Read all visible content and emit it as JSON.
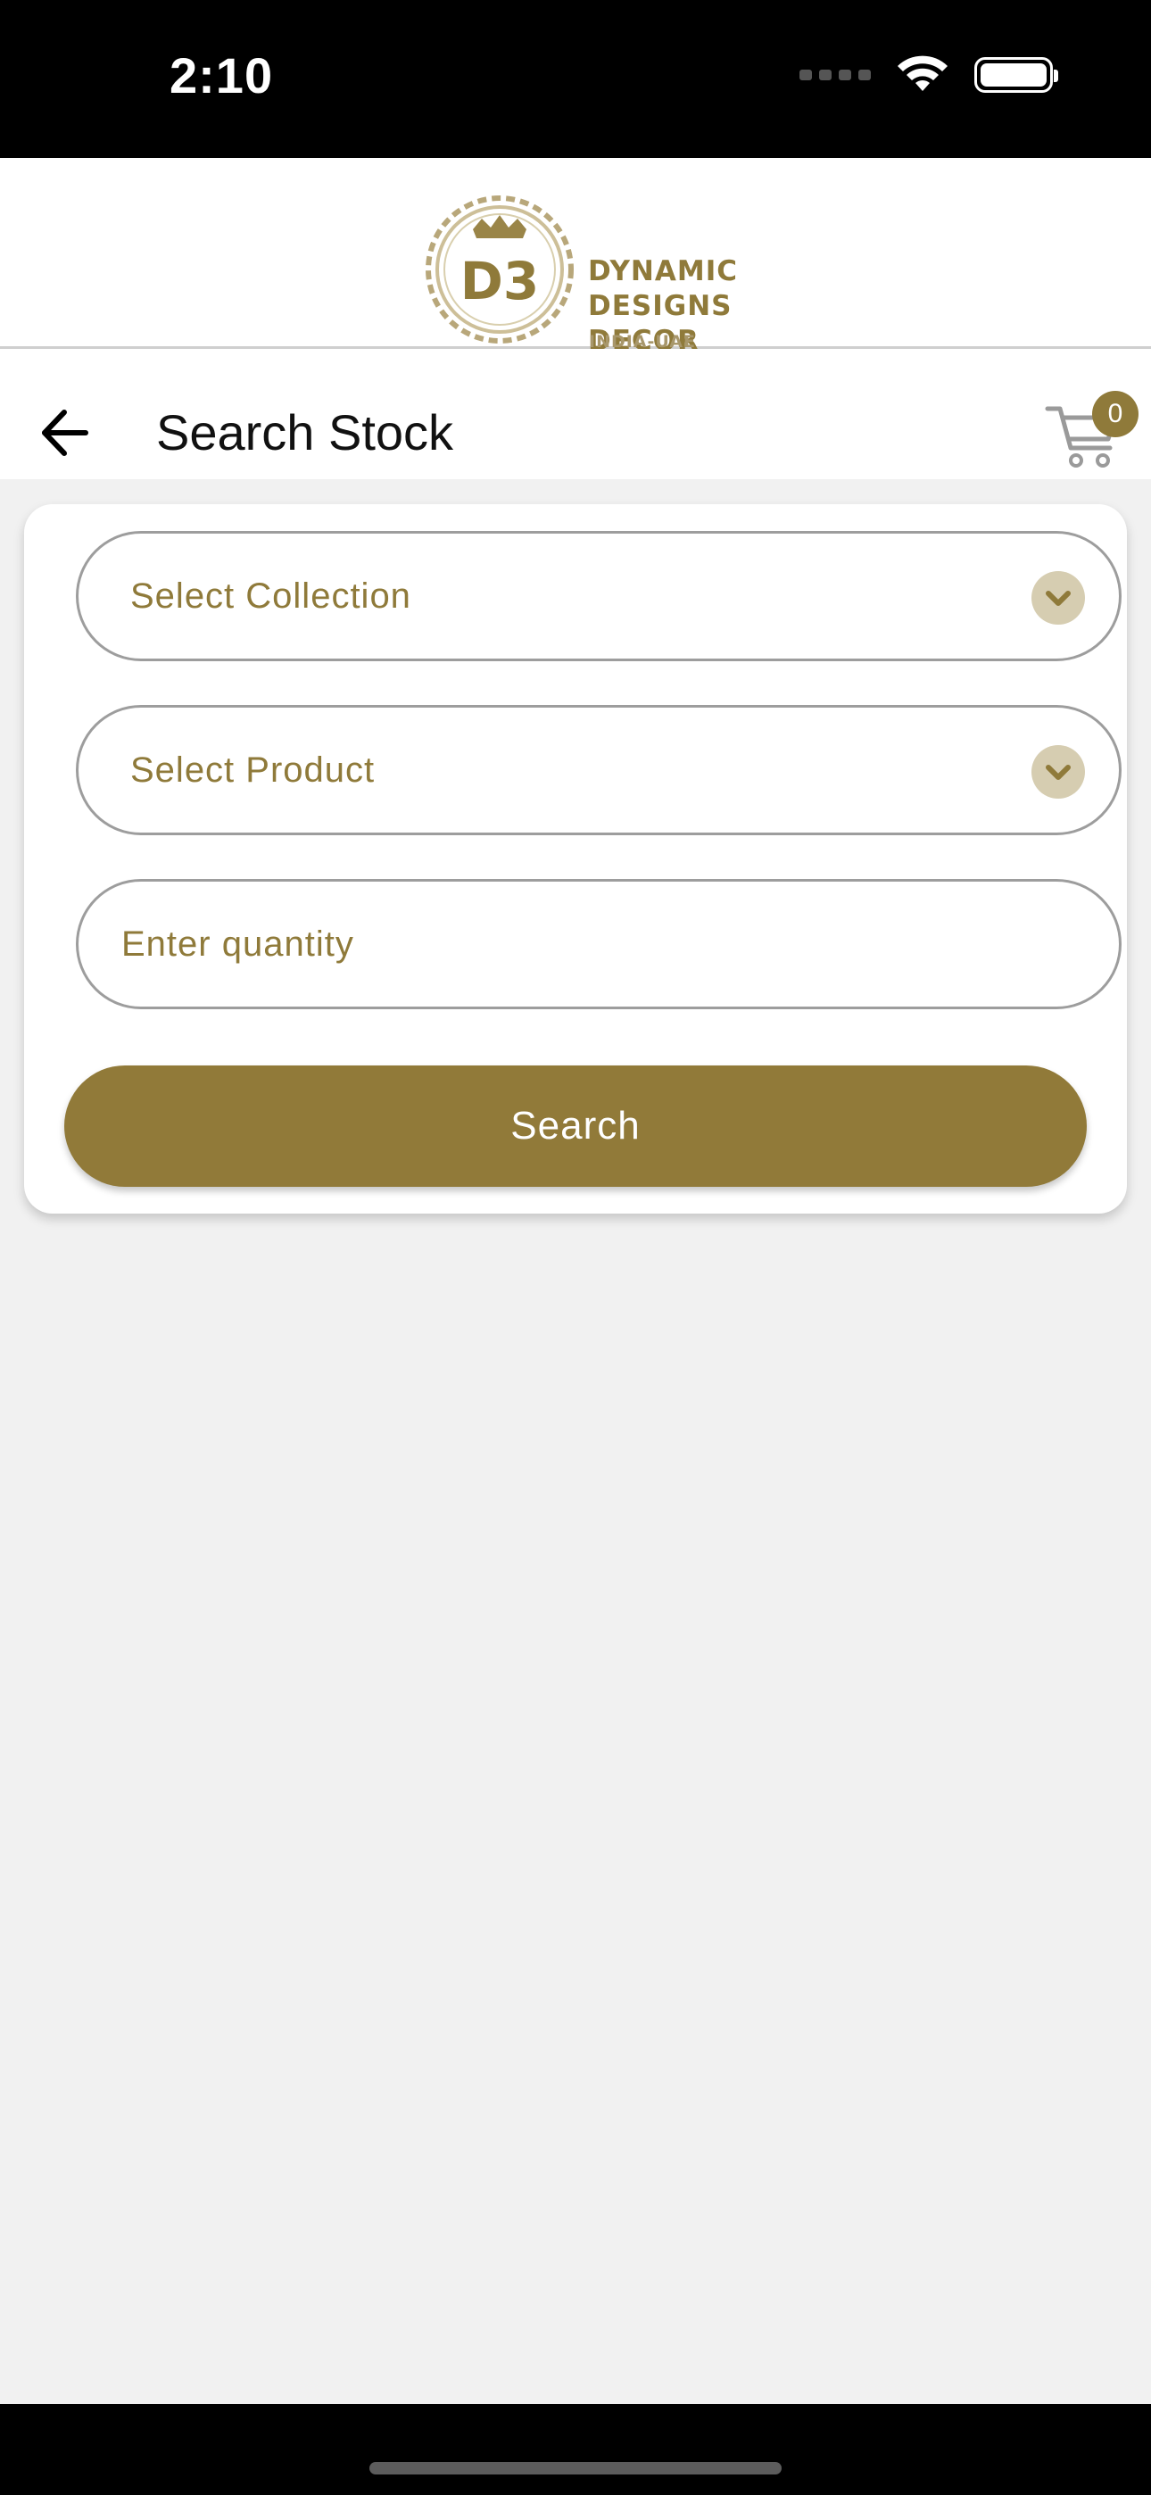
{
  "status_bar": {
    "time": "2:10"
  },
  "brand": {
    "logo_lines": [
      "DYNAMIC",
      "DESIGNS",
      "DECOR"
    ],
    "logo_sub": "INDIA-UAE",
    "accent_color": "#8f7a3a"
  },
  "header": {
    "title": "Search Stock",
    "cart_count": "0"
  },
  "form": {
    "collection_label": "Select Collection",
    "product_label": "Select Product",
    "quantity_placeholder": "Enter quantity",
    "search_label": "Search"
  },
  "icons": {
    "back": "arrow-left-icon",
    "cart": "cart-icon",
    "dropdown": "chevron-down-icon",
    "wifi": "wifi-icon",
    "battery": "battery-icon"
  }
}
